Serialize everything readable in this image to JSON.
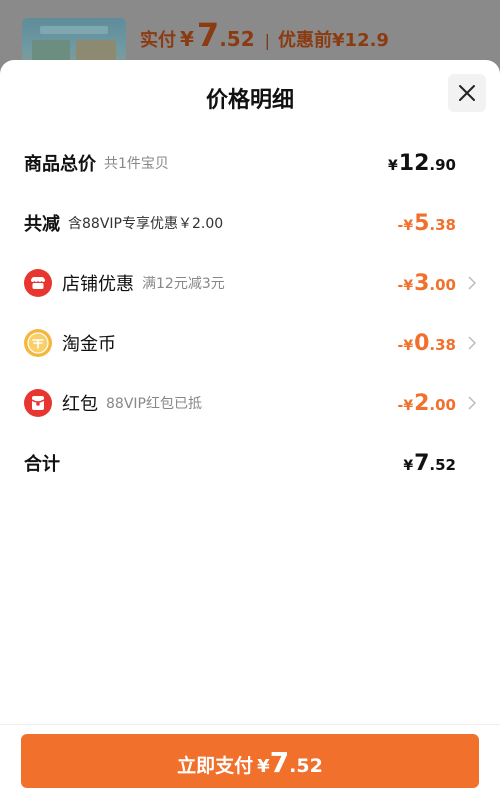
{
  "background": {
    "pay_label": "实付",
    "currency": "¥",
    "price_int": "7",
    "price_dec": ".52",
    "separator": "|",
    "before_label": "优惠前¥12.9"
  },
  "sheet": {
    "title": "价格明细"
  },
  "rows": {
    "subtotal": {
      "label": "商品总价",
      "detail": "共1件宝贝",
      "currency": "¥",
      "int": "12",
      "dec": ".90"
    },
    "total_discount": {
      "label": "共减",
      "detail": "含88VIP专享优惠￥2.00",
      "currency": "-¥",
      "int": "5",
      "dec": ".38"
    },
    "store_discount": {
      "label": "店铺优惠",
      "detail": "满12元减3元",
      "currency": "-¥",
      "int": "3",
      "dec": ".00",
      "icon": "store-icon"
    },
    "taojin_coin": {
      "label": "淘金币",
      "detail": "",
      "currency": "-¥",
      "int": "0",
      "dec": ".38",
      "icon": "gold-coin-icon"
    },
    "red_packet": {
      "label": "红包",
      "detail": "88VIP红包已抵",
      "currency": "-¥",
      "int": "2",
      "dec": ".00",
      "icon": "red-packet-icon"
    },
    "total": {
      "label": "合计",
      "currency": "¥",
      "int": "7",
      "dec": ".52"
    }
  },
  "footer": {
    "pay_button_label": "立即支付",
    "currency": "¥",
    "int": "7",
    "dec": ".52"
  },
  "colors": {
    "accent": "#f0702c",
    "store_icon": "#e8352f",
    "coin_icon": "#f5b63c",
    "red_packet_icon": "#e8352f"
  }
}
